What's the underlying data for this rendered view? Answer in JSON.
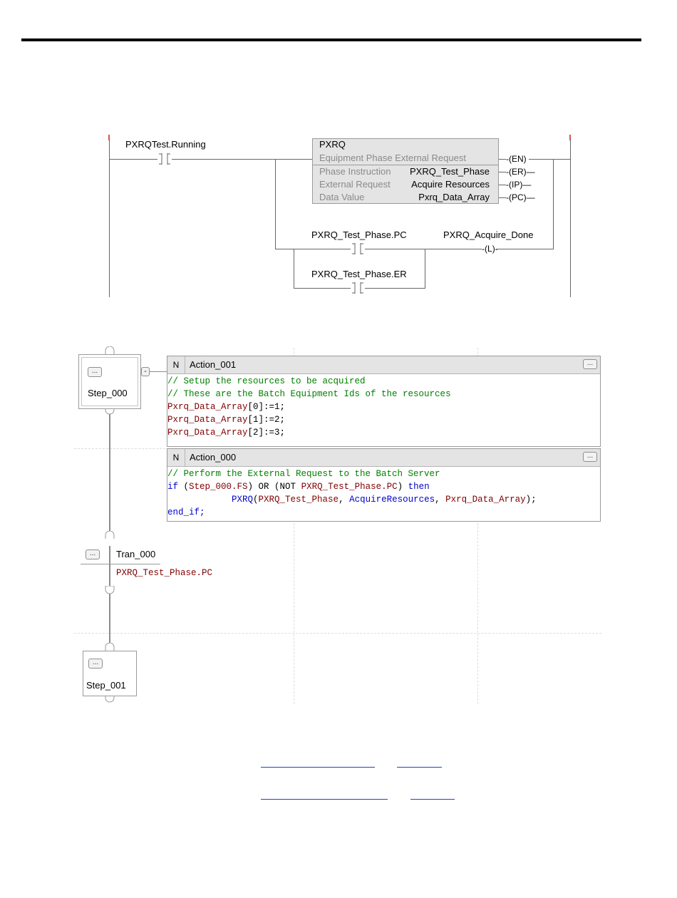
{
  "ladder": {
    "contact1_tag": "PXRQTest.Running",
    "instruction": {
      "name": "PXRQ",
      "description": "Equipment Phase External Request",
      "rows": [
        {
          "label": "Phase Instruction",
          "value": "PXRQ_Test_Phase"
        },
        {
          "label": "External Request",
          "value": "Acquire Resources"
        },
        {
          "label": "Data Value",
          "value": "Pxrq_Data_Array"
        }
      ],
      "outputs": [
        "EN",
        "ER",
        "IP",
        "PC"
      ]
    },
    "contact2_tag": "PXRQ_Test_Phase.PC",
    "contact3_tag": "PXRQ_Test_Phase.ER",
    "coil_tag": "PXRQ_Acquire_Done",
    "coil_symbol": "L"
  },
  "sfc": {
    "step0": {
      "label": "Step_000",
      "button": "..."
    },
    "collapse_button": "-",
    "action1": {
      "qualifier": "N",
      "name": "Action_001",
      "button": "...",
      "lines": [
        {
          "text": "// Setup the resources to be acquired",
          "color": "#008000"
        },
        {
          "text": "// These are the Batch Equipment Ids of the resources",
          "color": "#008000"
        }
      ],
      "assignments": [
        {
          "tag": "Pxrq_Data_Array",
          "rest": "[0]:=1;"
        },
        {
          "tag": "Pxrq_Data_Array",
          "rest": "[1]:=2;"
        },
        {
          "tag": "Pxrq_Data_Array",
          "rest": "[2]:=3;"
        }
      ]
    },
    "action0": {
      "qualifier": "N",
      "name": "Action_000",
      "button": "...",
      "comment": "// Perform the External Request to the Batch Server",
      "if_kw": "if",
      "cond_open": " (",
      "cond_tag1": "Step_000.FS",
      "cond_mid": ") OR (NOT ",
      "cond_tag2": "PXRQ_Test_Phase.PC",
      "cond_close": ") ",
      "then_kw": "then",
      "call_name": "PXRQ",
      "call_open": "(",
      "call_arg1": "PXRQ_Test_Phase",
      "call_sep1": ", ",
      "call_arg2": "AcquireResources",
      "call_sep2": ", ",
      "call_arg3": "Pxrq_Data_Array",
      "call_close": ");",
      "end_kw": "end_if;"
    },
    "transition": {
      "label": "Tran_000",
      "button": "...",
      "condition": "PXRQ_Test_Phase.PC"
    },
    "step1": {
      "label": "Step_001",
      "button": "..."
    }
  },
  "colors": {
    "comment": "#008000",
    "tag": "#800000",
    "keyword": "#0000cc",
    "link": "#2244bb"
  }
}
